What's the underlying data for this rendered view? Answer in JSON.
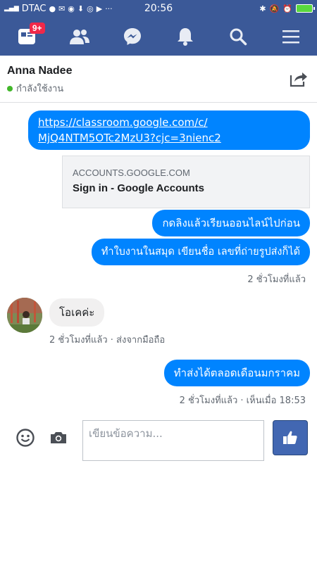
{
  "status_bar": {
    "signal": "4G",
    "carrier": "DTAC",
    "time": "20:56",
    "icons_left": [
      "carrier-signal-icon",
      "person-icon",
      "gmail-icon",
      "messenger-icon",
      "download-icon",
      "chrome-icon",
      "youtube-icon",
      "more-icon"
    ],
    "icons_right": [
      "bluetooth-icon",
      "mute-icon",
      "alarm-icon",
      "battery-charging-icon"
    ],
    "more": "···"
  },
  "nav": {
    "items": [
      "home-icon",
      "friends-icon",
      "messenger-icon",
      "notifications-icon",
      "search-icon",
      "menu-icon"
    ],
    "badge": "9+"
  },
  "header": {
    "name": "Anna Nadee",
    "status": "กำลังใช้งาน"
  },
  "messages": {
    "link_url": "https://classroom.google.com/c/MjQ4NTM5OTc2MzU3?cjc=3nienc2",
    "link_line1": "https://classroom.google.com/c/",
    "link_line2": "MjQ4NTM5OTc2MzU3?cjc=3nienc2",
    "preview_domain": "ACCOUNTS.GOOGLE.COM",
    "preview_title": "Sign in - Google Accounts",
    "out_1": "กดลิงแล้วเรียนออนไลน์ไปก่อน",
    "out_2": "ทำใบงานในสมุด เขียนชื่อ เลขที่ถ่ายรูปส่งก็ได้",
    "meta_1": "2 ชั่วโมงที่แล้ว",
    "in_1": "โอเคค่ะ",
    "meta_2": "2 ชั่วโมงที่แล้ว · ส่งจากมือถือ",
    "out_3": "ทำส่งได้ตลอดเดือนมกราคม",
    "meta_3": "2 ชั่วโมงที่แล้ว · เห็นเมื่อ 18:53"
  },
  "composer": {
    "placeholder": "เขียนข้อความ..."
  },
  "colors": {
    "brand": "#3b5998",
    "bubble_out": "#0084ff",
    "bubble_in": "#f1f0f0",
    "badge": "#f02849",
    "like_button": "#4267b2"
  }
}
